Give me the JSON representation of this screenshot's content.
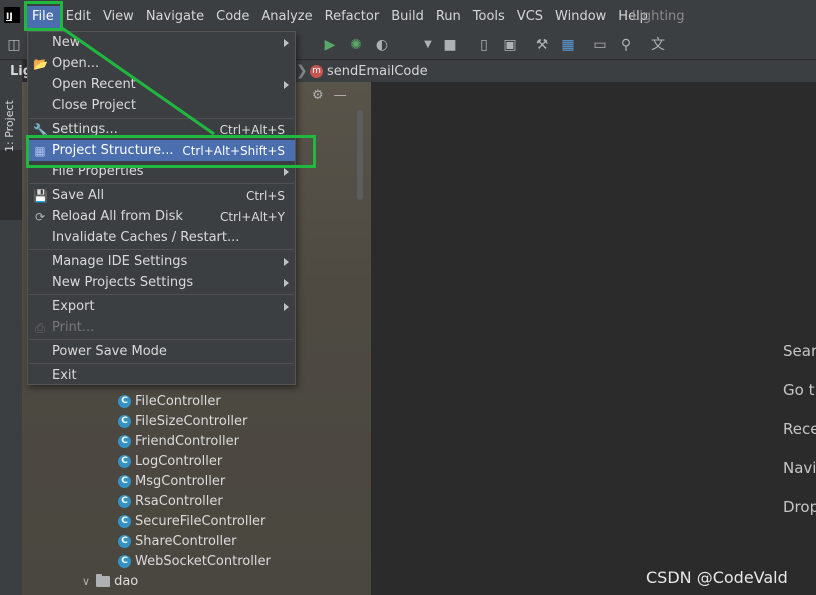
{
  "menubar": {
    "items": [
      "File",
      "Edit",
      "View",
      "Navigate",
      "Code",
      "Analyze",
      "Refactor",
      "Build",
      "Run",
      "Tools",
      "VCS",
      "Window",
      "Help"
    ],
    "project_name": "Lighting"
  },
  "toolbar": {
    "icons": [
      "folder-icon",
      "run-icon",
      "debug-icon",
      "coverage-icon",
      "dropdown-icon",
      "stop-icon",
      "device-icon",
      "sdk-icon",
      "settings-icon",
      "structure-icon",
      "layout-icon",
      "search-icon",
      "translate-icon"
    ]
  },
  "breadcrumb": {
    "method": "sendEmailCode",
    "method_badge": "m"
  },
  "tool_window": {
    "stripe_label": "1: Project",
    "header": "Lig"
  },
  "file_menu": {
    "items": [
      {
        "label": "New",
        "shortcut": "",
        "submenu": true,
        "icon": ""
      },
      {
        "label": "Open...",
        "shortcut": "",
        "submenu": false,
        "icon": "folder-open-icon"
      },
      {
        "label": "Open Recent",
        "shortcut": "",
        "submenu": true,
        "icon": ""
      },
      {
        "label": "Close Project",
        "shortcut": "",
        "submenu": false,
        "icon": ""
      },
      {
        "label": "Settings...",
        "shortcut": "Ctrl+Alt+S",
        "submenu": false,
        "icon": "wrench-icon"
      },
      {
        "label": "Project Structure...",
        "shortcut": "Ctrl+Alt+Shift+S",
        "submenu": false,
        "icon": "project-structure-icon",
        "selected": true
      },
      {
        "label": "File Properties",
        "shortcut": "",
        "submenu": true,
        "icon": ""
      },
      {
        "label": "Save All",
        "shortcut": "Ctrl+S",
        "submenu": false,
        "icon": "save-icon"
      },
      {
        "label": "Reload All from Disk",
        "shortcut": "Ctrl+Alt+Y",
        "submenu": false,
        "icon": "reload-icon"
      },
      {
        "label": "Invalidate Caches / Restart...",
        "shortcut": "",
        "submenu": false,
        "icon": ""
      },
      {
        "label": "Manage IDE Settings",
        "shortcut": "",
        "submenu": true,
        "icon": ""
      },
      {
        "label": "New Projects Settings",
        "shortcut": "",
        "submenu": true,
        "icon": ""
      },
      {
        "label": "Export",
        "shortcut": "",
        "submenu": true,
        "icon": ""
      },
      {
        "label": "Print...",
        "shortcut": "",
        "submenu": false,
        "icon": "print-icon",
        "disabled": true
      },
      {
        "label": "Power Save Mode",
        "shortcut": "",
        "submenu": false,
        "icon": ""
      },
      {
        "label": "Exit",
        "shortcut": "",
        "submenu": false,
        "icon": ""
      }
    ]
  },
  "project_tree": {
    "classes": [
      "FileController",
      "FileSizeController",
      "FriendController",
      "LogController",
      "MsgController",
      "RsaController",
      "SecureFileController",
      "ShareController",
      "WebSocketController"
    ],
    "class_badge": "C",
    "folder": "dao"
  },
  "editor_hints": [
    "Sear",
    "Go t",
    "Rece",
    "Navi",
    "Drop"
  ],
  "watermark": "CSDN @CodeVald",
  "colors": {
    "menu_bg": "#3c3f41",
    "selection": "#4b6eaf",
    "annotation": "#1fb93f",
    "class_icon": "#3592c4"
  }
}
